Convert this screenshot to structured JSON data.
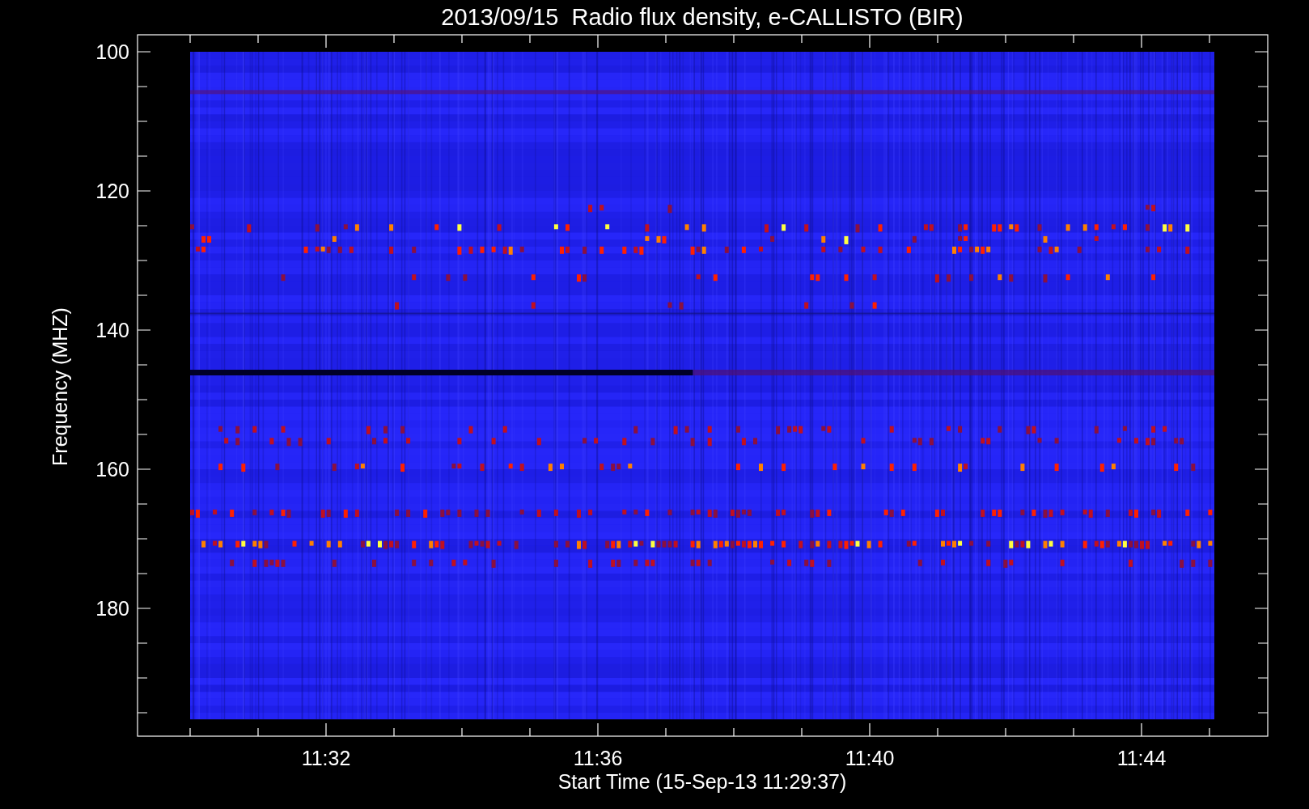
{
  "plot": {
    "title": "2013/09/15  Radio flux density, e-CALLISTO (BIR)",
    "y_label": "Frequency (MHZ)",
    "y_ticks": [
      "100",
      "120",
      "140",
      "160",
      "180"
    ],
    "x_label": "Start Time (15-Sep-13 11:29:37)",
    "x_ticks": [
      "11:32",
      "11:36",
      "11:40",
      "11:44"
    ]
  }
}
